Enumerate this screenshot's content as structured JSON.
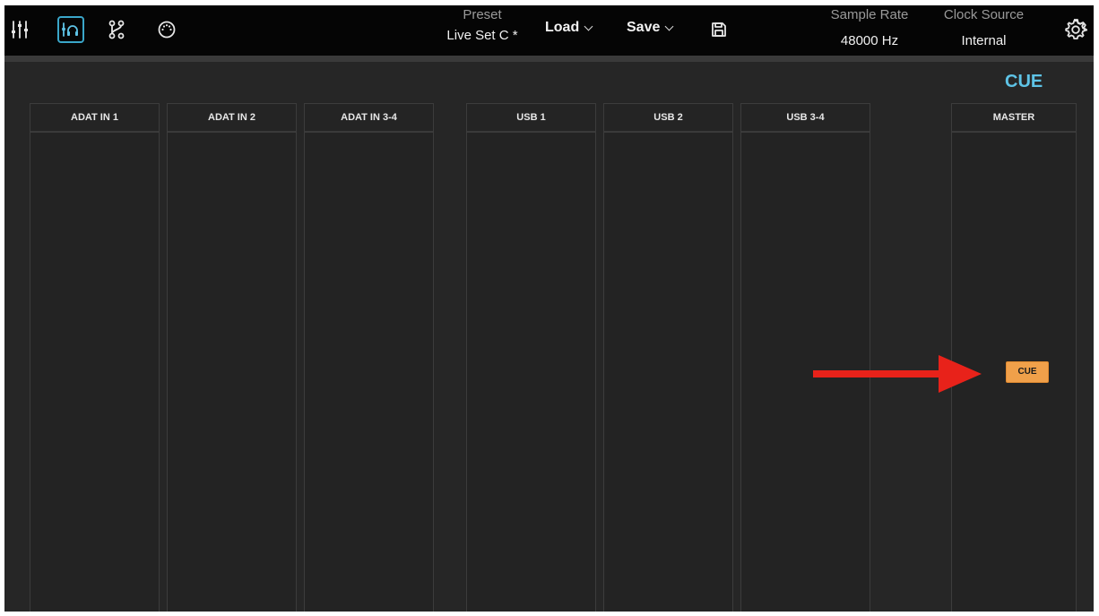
{
  "nav": {
    "icons": [
      "mixer-sliders-icon",
      "cue-headphones-icon",
      "routing-icon",
      "midi-port-icon"
    ],
    "active": "cue-headphones-icon"
  },
  "toolbar": {
    "preset_label": "Preset",
    "preset_value": "Live Set C *",
    "load_label": "Load",
    "save_label": "Save",
    "save_icon": "floppy-disk-icon",
    "sample_rate_label": "Sample Rate",
    "sample_rate_value": "48000 Hz",
    "clock_source_label": "Clock Source",
    "clock_source_value": "Internal",
    "settings_icon": "gear-icon"
  },
  "section": {
    "title": "CUE"
  },
  "channels": [
    {
      "name": "ADAT IN 1"
    },
    {
      "name": "ADAT IN 2"
    },
    {
      "name": "ADAT IN 3-4"
    },
    {
      "name": "USB 1"
    },
    {
      "name": "USB 2"
    },
    {
      "name": "USB 3-4"
    }
  ],
  "master": {
    "name": "MASTER",
    "cue_button_label": "CUE"
  },
  "colors": {
    "accent": "#5ec3e6",
    "cue_button": "#f0a04a",
    "annotation_arrow": "#e8221a",
    "background": "#262626",
    "topbar": "#050505"
  },
  "annotation": {
    "arrow_icon": "red-arrow-icon"
  }
}
